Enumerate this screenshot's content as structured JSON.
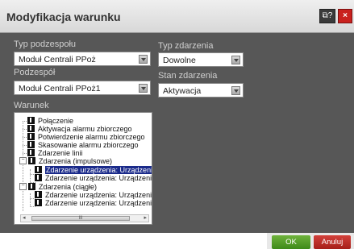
{
  "window": {
    "title": "Modyfikacja warunku"
  },
  "fields": {
    "typ_podzespolu": {
      "label": "Typ podzespołu",
      "value": "Moduł Centrali PPoż"
    },
    "podzespol": {
      "label": "Podzespół",
      "value": "Moduł Centrali PPoż1"
    },
    "typ_zdarzenia": {
      "label": "Typ zdarzenia",
      "value": "Dowolne"
    },
    "stan_zdarzenia": {
      "label": "Stan zdarzenia",
      "value": "Aktywacja"
    },
    "warunek": {
      "label": "Warunek"
    }
  },
  "tree": {
    "items": [
      "Połączenie",
      "Aktywacja alarmu zbiorczego",
      "Potwierdzenie alarmu zbiorczego",
      "Skasowanie alarmu zbiorczego",
      "Zdarzenie linii",
      "Zdarzenia (impulsowe)",
      "Zdarzenie urządzenia: Urządzenie per",
      "Zdarzenie urządzenia: Urządzenie per",
      "Zdarzenia (ciągłe)",
      "Zdarzenie urządzenia: Urządzenie per",
      "Zdarzenie urządzenia: Urządzenie per"
    ],
    "expanders": [
      "−",
      "−"
    ],
    "scroll_grip": "III"
  },
  "buttons": {
    "ok": "OK",
    "cancel": "Anuluj",
    "help": "⧉?",
    "close": "×"
  }
}
